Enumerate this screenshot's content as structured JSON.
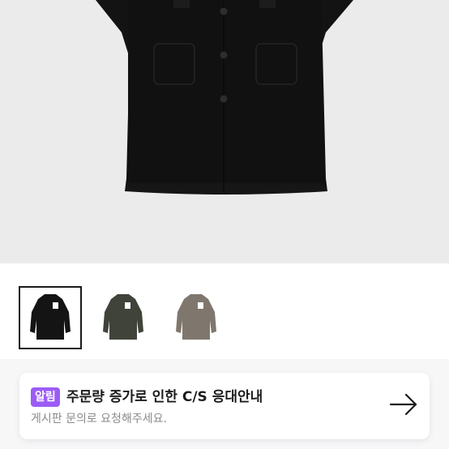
{
  "product": {
    "thumbnails": [
      {
        "color_name": "black",
        "coat_color": "#141414",
        "selected": true
      },
      {
        "color_name": "olive",
        "coat_color": "#3f433a",
        "selected": false
      },
      {
        "color_name": "taupe",
        "coat_color": "#7f776d",
        "selected": false
      }
    ]
  },
  "notice": {
    "badge": "알림",
    "title": "주문량 증가로 인한 C/S 응대안내",
    "subtitle": "게시판 문의로 요청해주세요.",
    "accent_color": "#9b5cf6",
    "action_icon": "arrow-right-icon"
  }
}
